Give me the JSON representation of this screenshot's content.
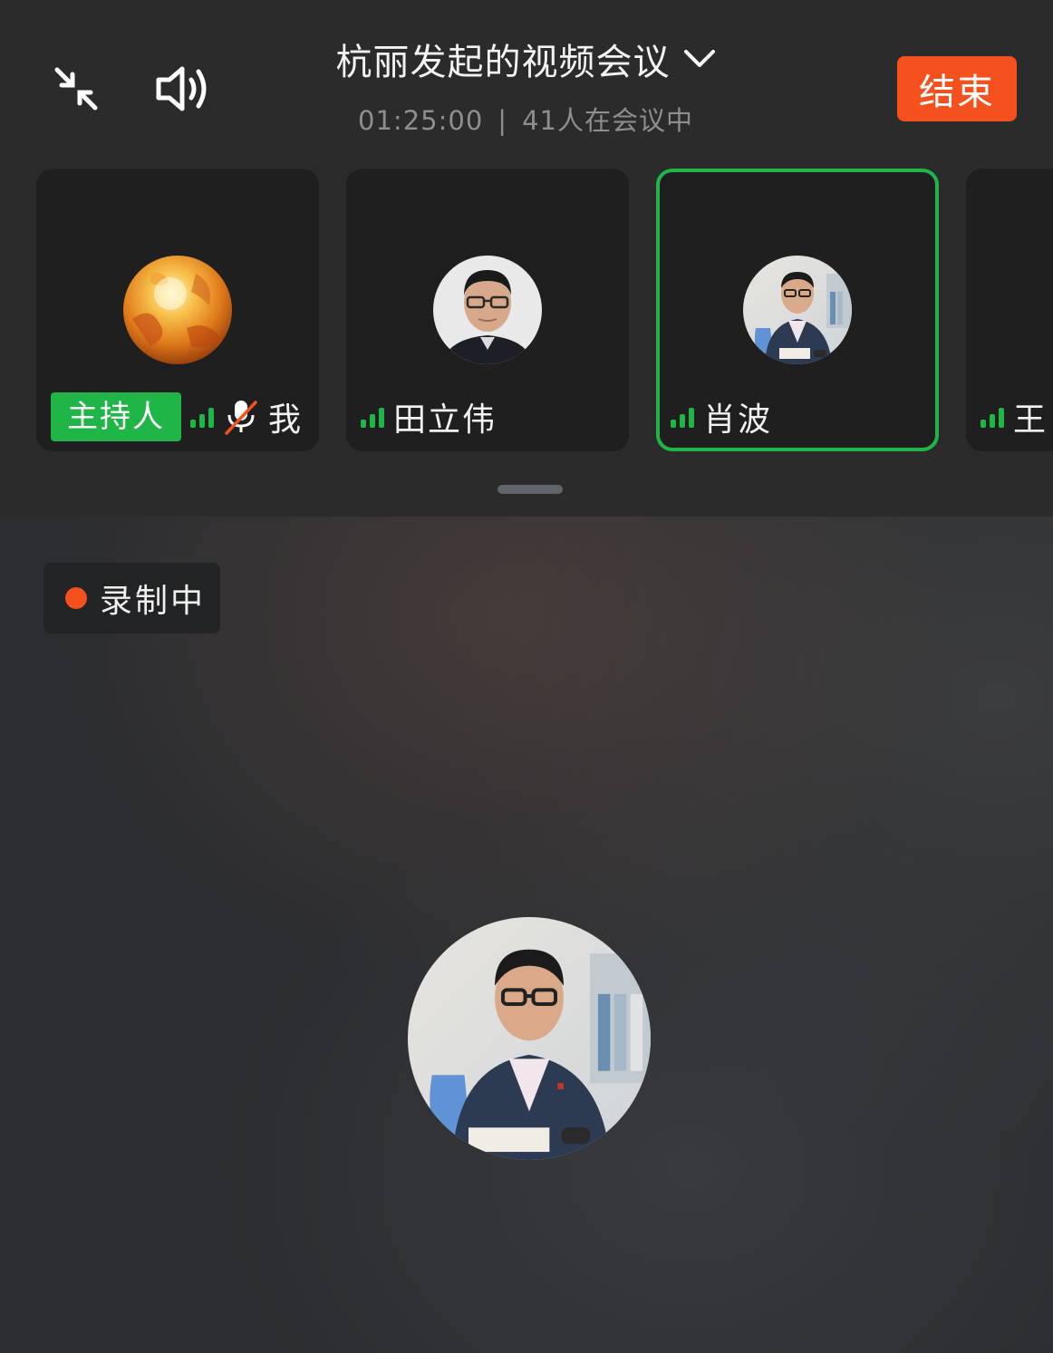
{
  "header": {
    "title": "杭丽发起的视频会议",
    "duration": "01:25:00",
    "separator": "|",
    "participants_text": "41人在会议中",
    "end_label": "结束",
    "icons": {
      "minimize": "minimize-icon",
      "speaker": "speaker-icon",
      "dropdown": "chevron-down-icon"
    }
  },
  "participants": [
    {
      "name": "我",
      "host_label": "主持人",
      "muted": true,
      "signal": 3,
      "active": false,
      "avatar": "autumn-leaves-avatar"
    },
    {
      "name": "田立伟",
      "signal": 3,
      "active": false,
      "avatar": "man-glasses-avatar"
    },
    {
      "name": "肖波",
      "signal": 3,
      "active": true,
      "avatar": "man-office-avatar"
    },
    {
      "name": "王",
      "signal": 3,
      "active": false,
      "avatar": ""
    }
  ],
  "stage": {
    "recording_label": "录制中",
    "speaker_avatar": "man-office-avatar"
  },
  "colors": {
    "accent_end": "#f5511e",
    "host_badge": "#1fb547",
    "active_border": "#1fb547",
    "signal": "#1fb547",
    "recording_dot": "#f5511e"
  }
}
